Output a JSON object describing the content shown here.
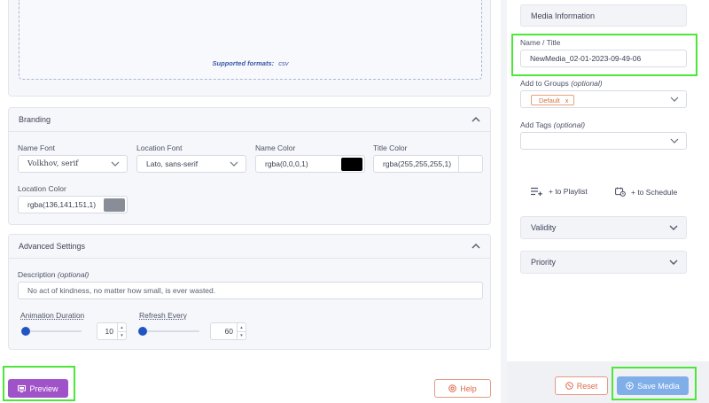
{
  "upload": {
    "formats_label": "Supported formats:",
    "formats_value": "csv"
  },
  "branding": {
    "title": "Branding",
    "name_font": {
      "label": "Name Font",
      "value": "Volkhov, serif"
    },
    "location_font": {
      "label": "Location Font",
      "value": "Lato, sans-serif"
    },
    "name_color": {
      "label": "Name Color",
      "value": "rgba(0,0,0,1)",
      "swatch": "#000000"
    },
    "title_color": {
      "label": "Title Color",
      "value": "rgba(255,255,255,1)",
      "swatch": "#ffffff"
    },
    "location_color": {
      "label": "Location Color",
      "value": "rgba(136,141,151,1)",
      "swatch": "#888d97"
    }
  },
  "advanced": {
    "title": "Advanced Settings",
    "description_label": "Description",
    "description_optional": "(optional)",
    "description_value": "No act of kindness, no matter how small, is ever wasted.",
    "animation_label": "Animation Duration",
    "animation_value": "10",
    "refresh_label": "Refresh Every",
    "refresh_value": "60"
  },
  "footer": {
    "preview_label": "Preview",
    "help_label": "Help"
  },
  "sidebar": {
    "section_title": "Media Information",
    "name_label": "Name / Title",
    "name_value": "NewMedia_02-01-2023-09-49-06",
    "groups_label": "Add to Groups",
    "groups_optional": "(optional)",
    "group_tag": "Default",
    "group_tag_remove": "x",
    "tags_label": "Add Tags",
    "tags_optional": "(optional)",
    "playlist_label": "+ to Playlist",
    "schedule_label": "+ to Schedule",
    "validity_label": "Validity",
    "priority_label": "Priority",
    "reset_label": "Reset",
    "save_label": "Save Media"
  },
  "colors": {
    "preview_button": "#a053c9",
    "save_button": "#80aee8",
    "highlight": "#4de63a",
    "accent_blue": "#2155c4"
  }
}
